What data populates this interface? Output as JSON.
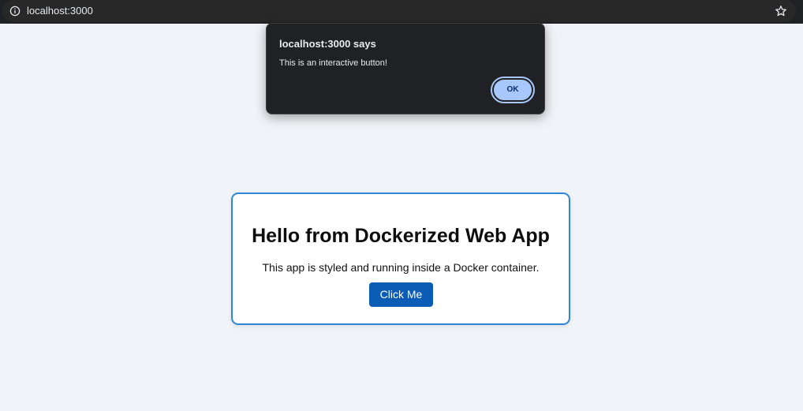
{
  "browser": {
    "url": "localhost:3000",
    "icons": {
      "info": "info-icon",
      "bookmark": "star-icon"
    }
  },
  "page": {
    "card": {
      "title": "Hello from Dockerized Web App",
      "description": "This app is styled and running inside a Docker container.",
      "button_label": "Click Me"
    },
    "colors": {
      "background": "#f0f3f7",
      "card_border": "#2f86d6",
      "button": "#0b5cb5"
    }
  },
  "dialog": {
    "title": "localhost:3000 says",
    "message": "This is an interactive button!",
    "ok_label": "OK",
    "colors": {
      "background": "#202124",
      "ok_button": "#a8c7fa"
    }
  }
}
